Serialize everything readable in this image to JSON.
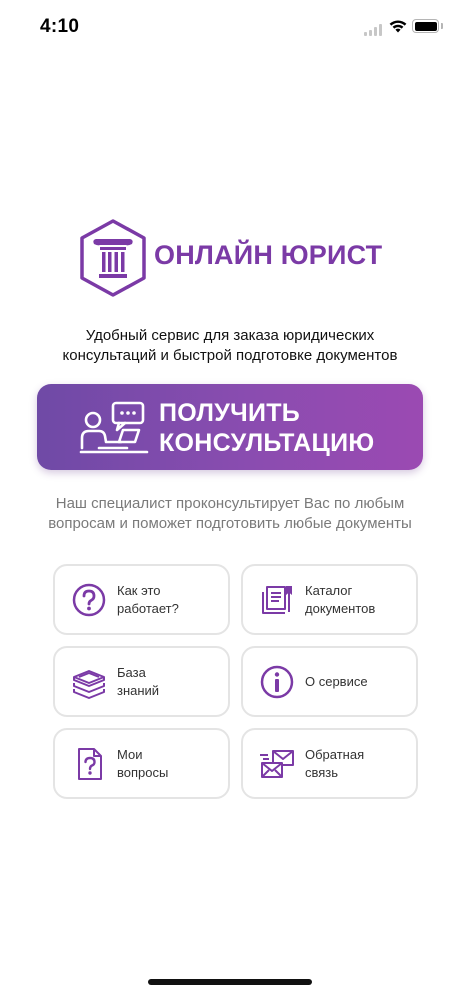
{
  "status_bar": {
    "time": "4:10"
  },
  "logo": {
    "text": "ОНЛАЙН ЮРИСТ"
  },
  "tagline": [
    "Удобный сервис для заказа юридических",
    "консультаций и быстрой подготовке документов"
  ],
  "cta": {
    "line1": "ПОЛУЧИТЬ",
    "line2": "КОНСУЛЬТАЦИЮ"
  },
  "subtext": [
    "Наш специалист проконсультирует Вас по любым",
    "вопросам и поможет подготовить любые документы"
  ],
  "tiles": [
    {
      "line1": "Как это",
      "line2": "работает?",
      "icon": "question-circle-icon"
    },
    {
      "line1": "Каталог",
      "line2": "документов",
      "icon": "documents-catalog-icon"
    },
    {
      "line1": "База",
      "line2": "знаний",
      "icon": "books-stack-icon"
    },
    {
      "line1": "О сервисе",
      "line2": "",
      "icon": "info-circle-icon"
    },
    {
      "line1": "Мои",
      "line2": "вопросы",
      "icon": "question-document-icon"
    },
    {
      "line1": "Обратная",
      "line2": "связь",
      "icon": "envelopes-icon"
    }
  ],
  "colors": {
    "brand": "#7b3aa6",
    "cta_start": "#6f4aa6",
    "cta_end": "#9b4ab2",
    "tile_border": "#e4e4e4"
  }
}
